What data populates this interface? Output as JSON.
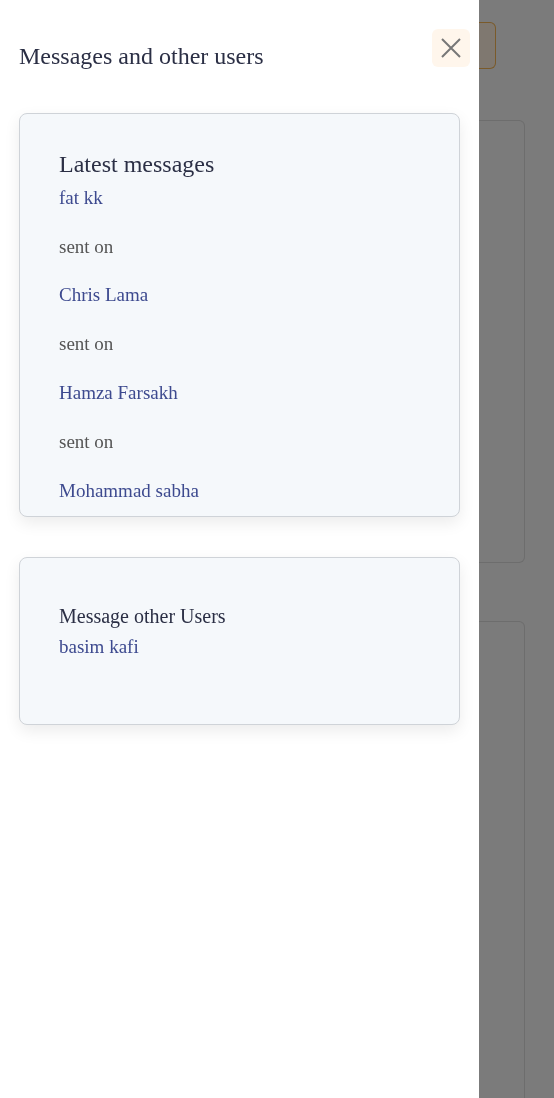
{
  "panel": {
    "title": "Messages and other users"
  },
  "latest_messages": {
    "heading": "Latest messages",
    "items": [
      {
        "name": "fat kk",
        "sent_label": "sent on"
      },
      {
        "name": "Chris Lama",
        "sent_label": "sent on"
      },
      {
        "name": "Hamza Farsakh",
        "sent_label": "sent on"
      },
      {
        "name": "Mohammad sabha"
      }
    ]
  },
  "other_users": {
    "heading": "Message other Users",
    "users": [
      "basim kafi"
    ]
  }
}
